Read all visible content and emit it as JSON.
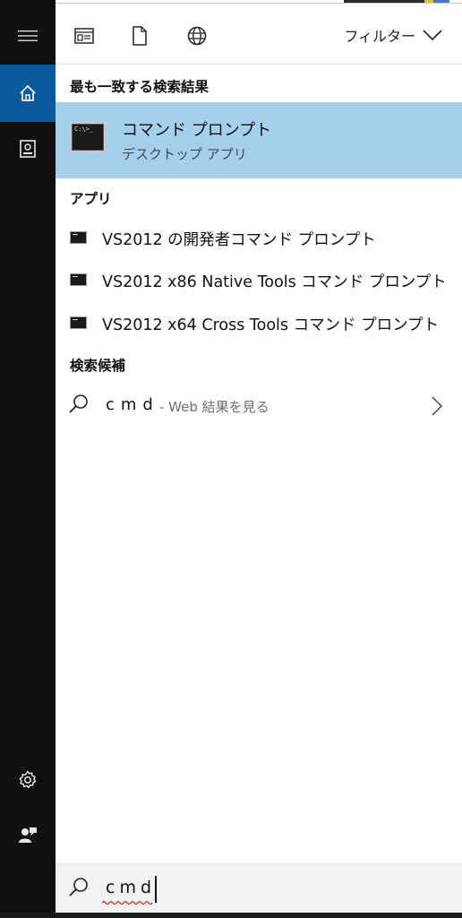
{
  "toolbar": {
    "filter_label": "フィルター"
  },
  "best_match": {
    "heading": "最も一致する検索結果",
    "title": "コマンド プロンプト",
    "subtitle": "デスクトップ アプリ",
    "thumb_text": "C:\\>_"
  },
  "apps": {
    "heading": "アプリ",
    "items": [
      {
        "label": "VS2012 の開発者コマンド プロンプト"
      },
      {
        "label": "VS2012 x86 Native Tools コマンド プロンプト"
      },
      {
        "label": "VS2012 x64 Cross Tools コマンド プロンプト"
      }
    ]
  },
  "suggestions": {
    "heading": "検索候補",
    "query": "cmd",
    "suffix": "- Web 結果を見る"
  },
  "search": {
    "value": "cmd"
  },
  "icons": {
    "rail": [
      "hamburger-icon",
      "home-icon",
      "notebook-icon",
      "gear-icon",
      "feedback-icon"
    ],
    "toolbar": [
      "apps-filter-icon",
      "documents-icon",
      "web-globe-icon",
      "chevron-down-icon"
    ]
  },
  "colors": {
    "rail_bg": "#101010",
    "rail_active": "#0a5a9c",
    "best_match_bg": "#a6cfee",
    "search_box_bg": "#f2f2f2"
  }
}
